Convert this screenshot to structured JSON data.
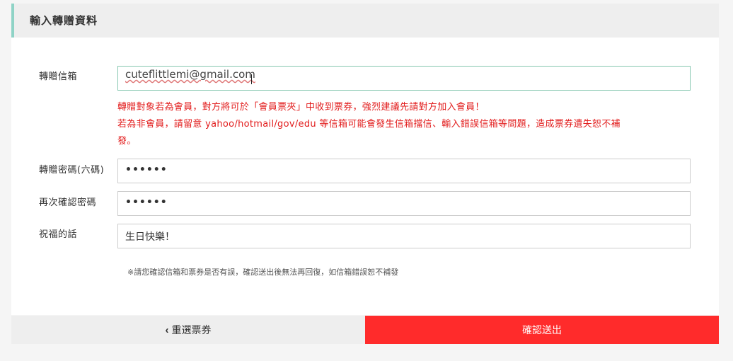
{
  "section": {
    "title": "輸入轉贈資料"
  },
  "form": {
    "email": {
      "label": "轉贈信箱",
      "value": "cuteflittlemi@gmail.com"
    },
    "warning_line1": "轉贈對象若為會員，對方將可於「會員票夾」中收到票券，強烈建議先請對方加入會員！",
    "warning_line2": "若為非會員，請留意 yahoo/hotmail/gov/edu 等信箱可能會發生信箱擋信、輸入錯誤信箱等問題，造成票券遺失恕不補",
    "warning_line3": "發。",
    "password": {
      "label": "轉贈密碼(六碼)",
      "value": "••••••"
    },
    "password_confirm": {
      "label": "再次確認密碼",
      "value": "••••••"
    },
    "message": {
      "label": "祝福的話",
      "value": "生日快樂！"
    },
    "note": "※請您確認信箱和票券是否有誤，確認送出後無法再回復，如信箱錯誤恕不補發"
  },
  "footer": {
    "back_icon": "chevron-left-icon",
    "back_label": "重選票券",
    "submit_label": "確認送出"
  },
  "colors": {
    "accent": "#8fd3c6",
    "warning": "#e21c1c",
    "submit": "#ff2b2b",
    "focus_border": "#86c7b0"
  }
}
